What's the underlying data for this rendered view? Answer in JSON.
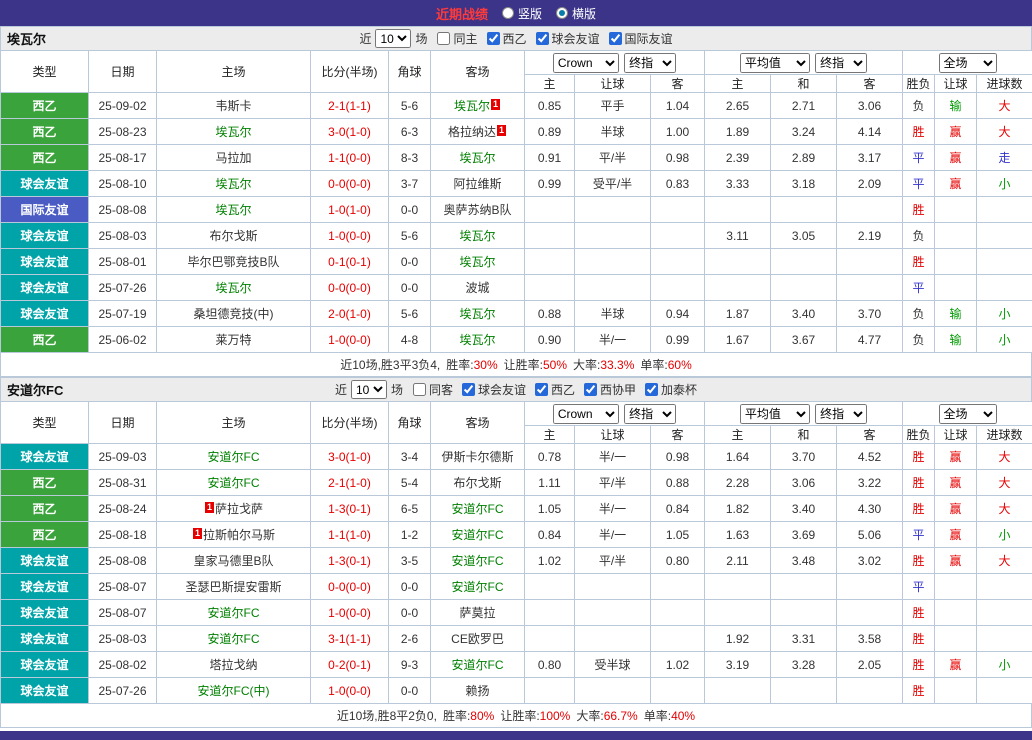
{
  "colors": {
    "accent_purple": "#3c3488",
    "title_red": "#ff3a3a",
    "type_green": "#3ba33b",
    "type_teal": "#00a3a8",
    "type_blue": "#4a5cc4",
    "win_red": "#e60000",
    "lose_green": "#009900",
    "draw_blue": "#3333cc",
    "neutral_dark": "#333333",
    "focus_green": "#008000",
    "grid_border": "#b9c9da",
    "filter_bg": "#ececec",
    "checkbox_blue": "#2468d9"
  },
  "topbar": {
    "title": "近期战绩",
    "options": [
      {
        "label": "竖版",
        "selected": false
      },
      {
        "label": "横版",
        "selected": true
      }
    ]
  },
  "filter_labels": {
    "near": "近",
    "games": "场"
  },
  "red_card": "1",
  "table_header": {
    "type": "类型",
    "date": "日期",
    "home": "主场",
    "score": "比分(半场)",
    "corner": "角球",
    "away": "客场",
    "bookmaker": "Crown",
    "final": "终指",
    "average": "平均值",
    "scope": "全场",
    "sub": [
      "主",
      "让球",
      "客",
      "主",
      "和",
      "客",
      "胜负",
      "让球",
      "进球数"
    ]
  },
  "type_styles": {
    "西乙": "green",
    "球会友谊": "teal",
    "国际友谊": "blue"
  },
  "result_colors": {
    "胜": "red",
    "平": "blue",
    "负": "dark",
    "赢": "red",
    "输": "green",
    "大": "red",
    "小": "green",
    "走": "blue"
  },
  "sections": [
    {
      "team": "埃瓦尔",
      "filter": {
        "count": "10",
        "checks": [
          {
            "label": "同主",
            "checked": false
          },
          {
            "label": "西乙",
            "checked": true
          },
          {
            "label": "球会友谊",
            "checked": true
          },
          {
            "label": "国际友谊",
            "checked": true
          }
        ]
      },
      "rows": [
        {
          "type": "西乙",
          "date": "25-09-02",
          "home": {
            "name": "韦斯卡"
          },
          "score": "2-1(1-1)",
          "corner": "5-6",
          "away": {
            "name": "埃瓦尔",
            "focus": true,
            "rc": "after"
          },
          "odds": [
            "0.85",
            "平手",
            "1.04"
          ],
          "avg": [
            "2.65",
            "2.71",
            "3.06"
          ],
          "res": "负",
          "asia": "输",
          "goal": "大"
        },
        {
          "type": "西乙",
          "date": "25-08-23",
          "home": {
            "name": "埃瓦尔",
            "focus": true
          },
          "score": "3-0(1-0)",
          "corner": "6-3",
          "away": {
            "name": "格拉纳达",
            "rc": "after"
          },
          "odds": [
            "0.89",
            "半球",
            "1.00"
          ],
          "avg": [
            "1.89",
            "3.24",
            "4.14"
          ],
          "res": "胜",
          "asia": "赢",
          "goal": "大"
        },
        {
          "type": "西乙",
          "date": "25-08-17",
          "home": {
            "name": "马拉加"
          },
          "score": "1-1(0-0)",
          "corner": "8-3",
          "away": {
            "name": "埃瓦尔",
            "focus": true
          },
          "odds": [
            "0.91",
            "平/半",
            "0.98"
          ],
          "avg": [
            "2.39",
            "2.89",
            "3.17"
          ],
          "res": "平",
          "asia": "赢",
          "goal": "走"
        },
        {
          "type": "球会友谊",
          "date": "25-08-10",
          "home": {
            "name": "埃瓦尔",
            "focus": true
          },
          "score": "0-0(0-0)",
          "corner": "3-7",
          "away": {
            "name": "阿拉维斯"
          },
          "odds": [
            "0.99",
            "受平/半",
            "0.83"
          ],
          "avg": [
            "3.33",
            "3.18",
            "2.09"
          ],
          "res": "平",
          "asia": "赢",
          "goal": "小"
        },
        {
          "type": "国际友谊",
          "date": "25-08-08",
          "home": {
            "name": "埃瓦尔",
            "focus": true
          },
          "score": "1-0(1-0)",
          "corner": "0-0",
          "away": {
            "name": "奥萨苏纳B队"
          },
          "odds": [
            "",
            "",
            ""
          ],
          "avg": [
            "",
            "",
            ""
          ],
          "res": "胜",
          "asia": "",
          "goal": ""
        },
        {
          "type": "球会友谊",
          "date": "25-08-03",
          "home": {
            "name": "布尔戈斯"
          },
          "score": "1-0(0-0)",
          "corner": "5-6",
          "away": {
            "name": "埃瓦尔",
            "focus": true
          },
          "odds": [
            "",
            "",
            ""
          ],
          "avg": [
            "3.11",
            "3.05",
            "2.19"
          ],
          "res": "负",
          "asia": "",
          "goal": ""
        },
        {
          "type": "球会友谊",
          "date": "25-08-01",
          "home": {
            "name": "毕尔巴鄂竞技B队"
          },
          "score": "0-1(0-1)",
          "corner": "0-0",
          "away": {
            "name": "埃瓦尔",
            "focus": true
          },
          "odds": [
            "",
            "",
            ""
          ],
          "avg": [
            "",
            "",
            ""
          ],
          "res": "胜",
          "asia": "",
          "goal": ""
        },
        {
          "type": "球会友谊",
          "date": "25-07-26",
          "home": {
            "name": "埃瓦尔",
            "focus": true
          },
          "score": "0-0(0-0)",
          "corner": "0-0",
          "away": {
            "name": "波城"
          },
          "odds": [
            "",
            "",
            ""
          ],
          "avg": [
            "",
            "",
            ""
          ],
          "res": "平",
          "asia": "",
          "goal": ""
        },
        {
          "type": "球会友谊",
          "date": "25-07-19",
          "home": {
            "name": "桑坦德竞技(中)"
          },
          "score": "2-0(1-0)",
          "corner": "5-6",
          "away": {
            "name": "埃瓦尔",
            "focus": true
          },
          "odds": [
            "0.88",
            "半球",
            "0.94"
          ],
          "avg": [
            "1.87",
            "3.40",
            "3.70"
          ],
          "res": "负",
          "asia": "输",
          "goal": "小"
        },
        {
          "type": "西乙",
          "date": "25-06-02",
          "home": {
            "name": "莱万特"
          },
          "score": "1-0(0-0)",
          "corner": "4-8",
          "away": {
            "name": "埃瓦尔",
            "focus": true
          },
          "odds": [
            "0.90",
            "半/一",
            "0.99"
          ],
          "avg": [
            "1.67",
            "3.67",
            "4.77"
          ],
          "res": "负",
          "asia": "输",
          "goal": "小"
        }
      ],
      "summary": {
        "prefix": "近10场,胜3平3负4,",
        "stats": [
          {
            "label": "胜率:",
            "value": "30%"
          },
          {
            "label": "让胜率:",
            "value": "50%"
          },
          {
            "label": "大率:",
            "value": "33.3%"
          },
          {
            "label": "单率:",
            "value": "60%"
          }
        ]
      }
    },
    {
      "team": "安道尔FC",
      "filter": {
        "count": "10",
        "checks": [
          {
            "label": "同客",
            "checked": false
          },
          {
            "label": "球会友谊",
            "checked": true
          },
          {
            "label": "西乙",
            "checked": true
          },
          {
            "label": "西协甲",
            "checked": true
          },
          {
            "label": "加泰杯",
            "checked": true
          }
        ]
      },
      "rows": [
        {
          "type": "球会友谊",
          "date": "25-09-03",
          "home": {
            "name": "安道尔FC",
            "focus": true
          },
          "score": "3-0(1-0)",
          "corner": "3-4",
          "away": {
            "name": "伊斯卡尔德斯"
          },
          "odds": [
            "0.78",
            "半/一",
            "0.98"
          ],
          "avg": [
            "1.64",
            "3.70",
            "4.52"
          ],
          "res": "胜",
          "asia": "赢",
          "goal": "大"
        },
        {
          "type": "西乙",
          "date": "25-08-31",
          "home": {
            "name": "安道尔FC",
            "focus": true
          },
          "score": "2-1(1-0)",
          "corner": "5-4",
          "away": {
            "name": "布尔戈斯"
          },
          "odds": [
            "1.11",
            "平/半",
            "0.88"
          ],
          "avg": [
            "2.28",
            "3.06",
            "3.22"
          ],
          "res": "胜",
          "asia": "赢",
          "goal": "大"
        },
        {
          "type": "西乙",
          "date": "25-08-24",
          "home": {
            "name": "萨拉戈萨",
            "rc": "before"
          },
          "score": "1-3(0-1)",
          "corner": "6-5",
          "away": {
            "name": "安道尔FC",
            "focus": true
          },
          "odds": [
            "1.05",
            "半/一",
            "0.84"
          ],
          "avg": [
            "1.82",
            "3.40",
            "4.30"
          ],
          "res": "胜",
          "asia": "赢",
          "goal": "大"
        },
        {
          "type": "西乙",
          "date": "25-08-18",
          "home": {
            "name": "拉斯帕尔马斯",
            "rc": "before"
          },
          "score": "1-1(1-0)",
          "corner": "1-2",
          "away": {
            "name": "安道尔FC",
            "focus": true
          },
          "odds": [
            "0.84",
            "半/一",
            "1.05"
          ],
          "avg": [
            "1.63",
            "3.69",
            "5.06"
          ],
          "res": "平",
          "asia": "赢",
          "goal": "小"
        },
        {
          "type": "球会友谊",
          "date": "25-08-08",
          "home": {
            "name": "皇家马德里B队"
          },
          "score": "1-3(0-1)",
          "corner": "3-5",
          "away": {
            "name": "安道尔FC",
            "focus": true
          },
          "odds": [
            "1.02",
            "平/半",
            "0.80"
          ],
          "avg": [
            "2.11",
            "3.48",
            "3.02"
          ],
          "res": "胜",
          "asia": "赢",
          "goal": "大"
        },
        {
          "type": "球会友谊",
          "date": "25-08-07",
          "home": {
            "name": "圣瑟巴斯提安雷斯"
          },
          "score": "0-0(0-0)",
          "corner": "0-0",
          "away": {
            "name": "安道尔FC",
            "focus": true
          },
          "odds": [
            "",
            "",
            ""
          ],
          "avg": [
            "",
            "",
            ""
          ],
          "res": "平",
          "asia": "",
          "goal": ""
        },
        {
          "type": "球会友谊",
          "date": "25-08-07",
          "home": {
            "name": "安道尔FC",
            "focus": true
          },
          "score": "1-0(0-0)",
          "corner": "0-0",
          "away": {
            "name": "萨莫拉"
          },
          "odds": [
            "",
            "",
            ""
          ],
          "avg": [
            "",
            "",
            ""
          ],
          "res": "胜",
          "asia": "",
          "goal": ""
        },
        {
          "type": "球会友谊",
          "date": "25-08-03",
          "home": {
            "name": "安道尔FC",
            "focus": true
          },
          "score": "3-1(1-1)",
          "corner": "2-6",
          "away": {
            "name": "CE欧罗巴"
          },
          "odds": [
            "",
            "",
            ""
          ],
          "avg": [
            "1.92",
            "3.31",
            "3.58"
          ],
          "res": "胜",
          "asia": "",
          "goal": ""
        },
        {
          "type": "球会友谊",
          "date": "25-08-02",
          "home": {
            "name": "塔拉戈纳"
          },
          "score": "0-2(0-1)",
          "corner": "9-3",
          "away": {
            "name": "安道尔FC",
            "focus": true
          },
          "odds": [
            "0.80",
            "受半球",
            "1.02"
          ],
          "avg": [
            "3.19",
            "3.28",
            "2.05"
          ],
          "res": "胜",
          "asia": "赢",
          "goal": "小"
        },
        {
          "type": "球会友谊",
          "date": "25-07-26",
          "home": {
            "name": "安道尔FC(中)",
            "focus": true
          },
          "score": "1-0(0-0)",
          "corner": "0-0",
          "away": {
            "name": "赖扬"
          },
          "odds": [
            "",
            "",
            ""
          ],
          "avg": [
            "",
            "",
            ""
          ],
          "res": "胜",
          "asia": "",
          "goal": ""
        }
      ],
      "summary": {
        "prefix": "近10场,胜8平2负0,",
        "stats": [
          {
            "label": "胜率:",
            "value": "80%"
          },
          {
            "label": "让胜率:",
            "value": "100%"
          },
          {
            "label": "大率:",
            "value": "66.7%"
          },
          {
            "label": "单率:",
            "value": "40%"
          }
        ]
      }
    }
  ]
}
